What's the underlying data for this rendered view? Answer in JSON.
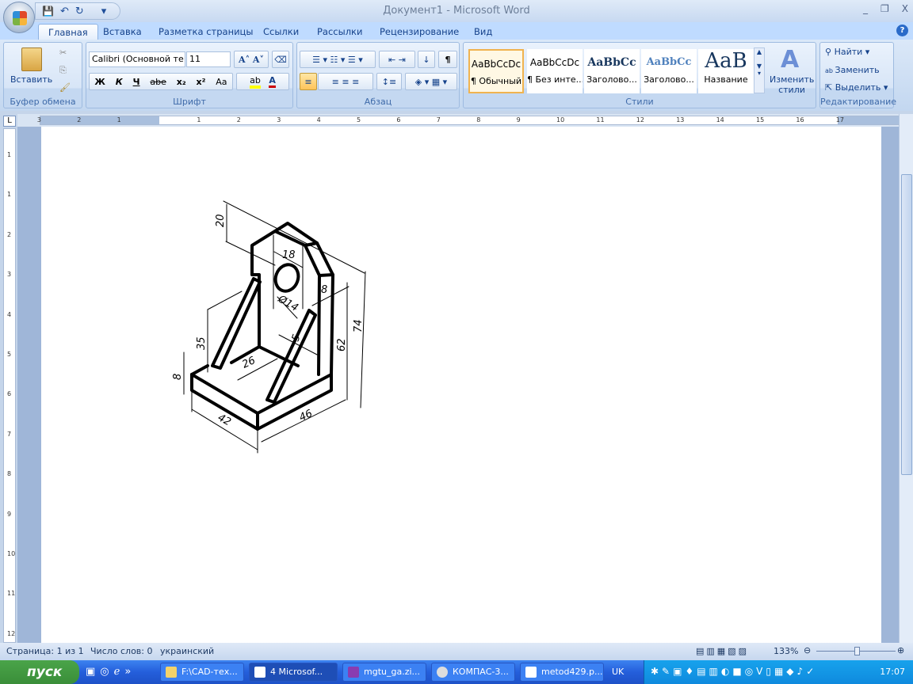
{
  "title_bar": {
    "title": "Документ1 - Microsoft Word",
    "minimize": "_",
    "restore": "❐",
    "close": "X"
  },
  "qat": {
    "save": "💾",
    "undo": "↶",
    "redo": "↻",
    "customize": "▾"
  },
  "tabs": [
    "Главная",
    "Вставка",
    "Разметка страницы",
    "Ссылки",
    "Рассылки",
    "Рецензирование",
    "Вид"
  ],
  "help": "?",
  "clipboard": {
    "label": "Буфер обмена",
    "paste": "Вставить"
  },
  "font": {
    "label": "Шрифт",
    "font_name": "Calibri (Основной те",
    "font_size": "11",
    "bold": "Ж",
    "italic": "К",
    "underline": "Ч",
    "strike": "abe",
    "sub": "x₂",
    "sup": "x²",
    "case": "Aa",
    "grow": "A˄",
    "shrink": "A˅"
  },
  "paragraph": {
    "label": "Абзац",
    "pilcrow": "¶"
  },
  "styles": {
    "label": "Стили",
    "items": [
      {
        "preview": "AaBbCcDc",
        "name": "¶ Обычный"
      },
      {
        "preview": "AaBbCcDc",
        "name": "¶ Без инте..."
      },
      {
        "preview": "AaBbCc",
        "name": "Заголово..."
      },
      {
        "preview": "AaBbCc",
        "name": "Заголово..."
      },
      {
        "preview": "AaB",
        "name": "Название"
      }
    ],
    "change": "Изменить стили"
  },
  "editing": {
    "label": "Редактирование",
    "find": "Найти",
    "replace": "Заменить",
    "select": "Выделить"
  },
  "ruler": {
    "corner": "L",
    "numbers": [
      "3",
      "2",
      "1",
      "1",
      "2",
      "3",
      "4",
      "5",
      "6",
      "7",
      "8",
      "9",
      "10",
      "11",
      "12",
      "13",
      "14",
      "15",
      "16",
      "17"
    ],
    "vnumbers": [
      "1",
      "1",
      "2",
      "3",
      "4",
      "5",
      "6",
      "7",
      "8",
      "9",
      "10",
      "11",
      "12"
    ]
  },
  "drawing": {
    "dims": [
      "20",
      "18",
      "Ø14",
      "8",
      "74",
      "62",
      "35",
      "26",
      "5",
      "8",
      "42",
      "46"
    ]
  },
  "status": {
    "page": "Страница: 1 из 1",
    "words": "Число слов: 0",
    "language": "украинский",
    "zoom": "133%",
    "zoom_level_percent": 133
  },
  "taskbar": {
    "start": "пуск",
    "tasks": [
      {
        "label": "F:\\CAD-тех...",
        "active": false
      },
      {
        "label": "4 Microsof...",
        "active": true
      },
      {
        "label": "mgtu_ga.zi...",
        "active": false
      },
      {
        "label": "КОМПАС-3...",
        "active": false
      },
      {
        "label": "metod429.p...",
        "active": false
      }
    ],
    "lang": "UK",
    "clock": "17:07"
  },
  "colors": {
    "ribbon": "#c3d7f0",
    "taskbar": "#245edb",
    "start": "#3a8e39",
    "selected_style": "#f9c46b"
  }
}
